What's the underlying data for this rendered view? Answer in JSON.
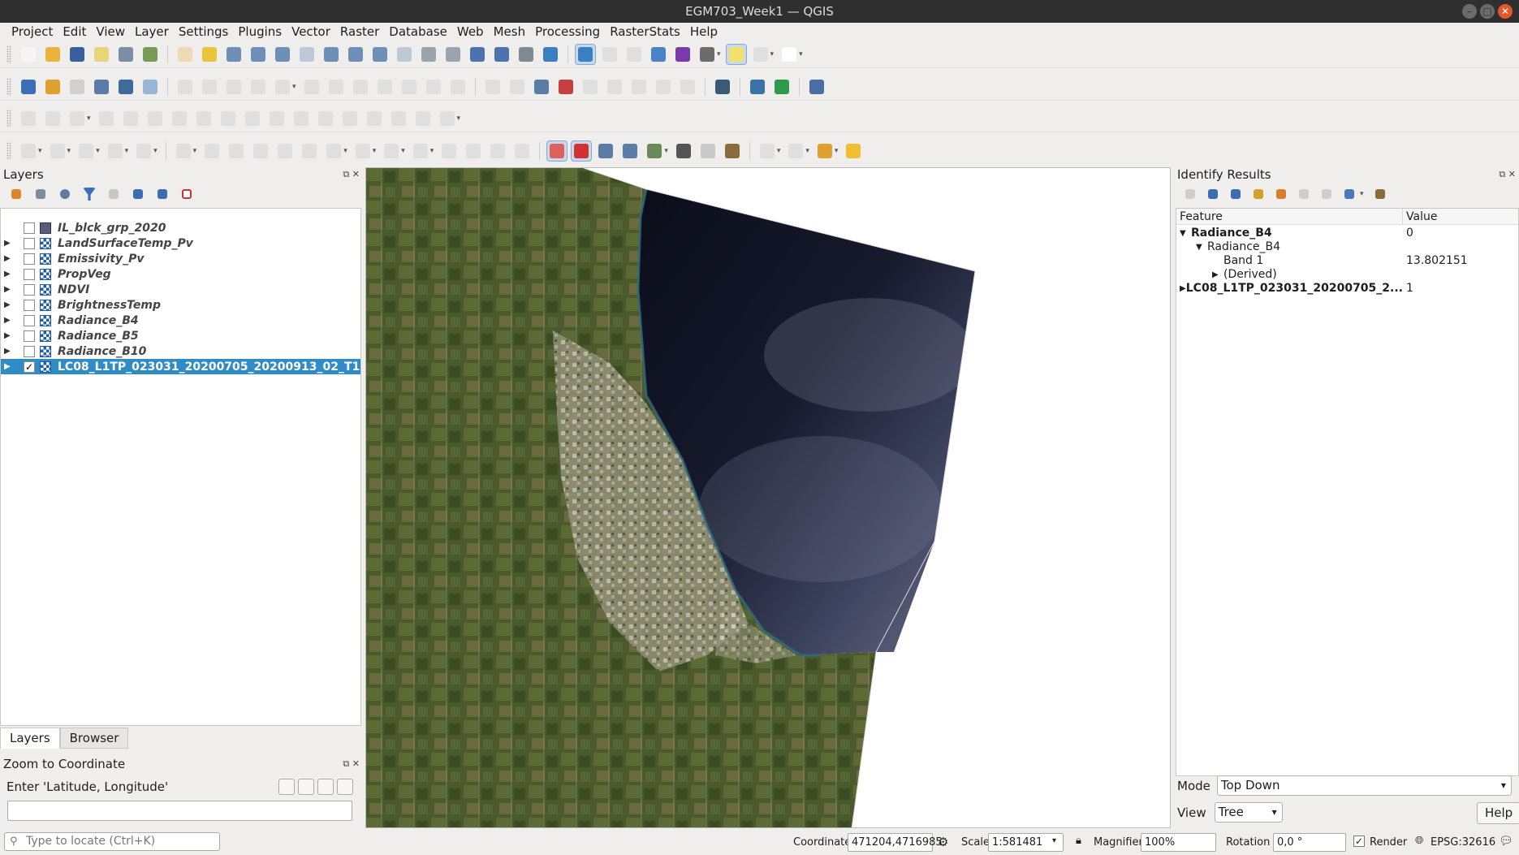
{
  "window": {
    "title": "EGM703_Week1 — QGIS"
  },
  "menu": [
    "Project",
    "Edit",
    "View",
    "Layer",
    "Settings",
    "Plugins",
    "Vector",
    "Raster",
    "Database",
    "Web",
    "Mesh",
    "Processing",
    "RasterStats",
    "Help"
  ],
  "layers_panel": {
    "title": "Layers",
    "layers": [
      {
        "name": "IL_blck_grp_2020",
        "type": "vector",
        "checked": false,
        "expandable": false
      },
      {
        "name": "LandSurfaceTemp_Pv",
        "type": "raster",
        "checked": false,
        "expandable": true
      },
      {
        "name": "Emissivity_Pv",
        "type": "raster",
        "checked": false,
        "expandable": true
      },
      {
        "name": "PropVeg",
        "type": "raster",
        "checked": false,
        "expandable": true
      },
      {
        "name": "NDVI",
        "type": "raster",
        "checked": false,
        "expandable": true
      },
      {
        "name": "BrightnessTemp",
        "type": "raster",
        "checked": false,
        "expandable": true
      },
      {
        "name": "Radiance_B4",
        "type": "raster",
        "checked": false,
        "expandable": true
      },
      {
        "name": "Radiance_B5",
        "type": "raster",
        "checked": false,
        "expandable": true
      },
      {
        "name": "Radiance_B10",
        "type": "raster",
        "checked": false,
        "expandable": true
      },
      {
        "name": "LC08_L1TP_023031_20200705_20200913_02_T1",
        "type": "raster",
        "checked": true,
        "expandable": true,
        "selected": true
      }
    ],
    "tabs": [
      "Layers",
      "Browser"
    ]
  },
  "zoom_panel": {
    "title": "Zoom to Coordinate",
    "label": "Enter 'Latitude, Longitude'",
    "value": ""
  },
  "identify": {
    "title": "Identify Results",
    "headers": [
      "Feature",
      "Value"
    ],
    "rows": [
      {
        "indent": 0,
        "arrow": "down",
        "feature": "Radiance_B4",
        "value": "0",
        "bold": true
      },
      {
        "indent": 1,
        "arrow": "down",
        "feature": "Radiance_B4",
        "value": "",
        "bold": false
      },
      {
        "indent": 2,
        "arrow": "",
        "feature": "Band 1",
        "value": "13.802151",
        "bold": false
      },
      {
        "indent": 2,
        "arrow": "right",
        "feature": "(Derived)",
        "value": "",
        "bold": false
      },
      {
        "indent": 0,
        "arrow": "right",
        "feature": "LC08_L1TP_023031_20200705_2...",
        "value": "1",
        "bold": true
      }
    ],
    "mode_label": "Mode",
    "mode_value": "Top Down",
    "view_label": "View",
    "view_value": "Tree",
    "help_label": "Help"
  },
  "status": {
    "locator_placeholder": "Type to locate (Ctrl+K)",
    "coordinate_label": "Coordinate",
    "coordinate_value": "471204,4716985",
    "scale_label": "Scale",
    "scale_value": "1:581481",
    "magnifier_label": "Magnifier",
    "magnifier_value": "100%",
    "rotation_label": "Rotation",
    "rotation_value": "0,0 °",
    "render_label": "Render",
    "crs": "EPSG:32616"
  },
  "colors": {
    "selection": "#308cc6",
    "titlebar": "#2f2f2f",
    "close_button": "#e4572e"
  }
}
